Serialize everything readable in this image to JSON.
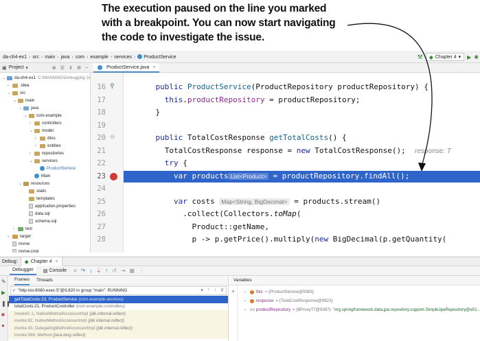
{
  "callout": {
    "text_line1": "The execution paused on the line you marked",
    "text_line2": "with a breakpoint. You can now start navigating",
    "text_line3": "the code to investigate the issue."
  },
  "breadcrumb": [
    "da-ch4-ex1",
    "src",
    "main",
    "java",
    "com",
    "example",
    "services",
    "ProductService"
  ],
  "toolbar": {
    "run_config": "Chapter 4"
  },
  "project_panel": {
    "title": "Project",
    "tree": [
      {
        "label": "da-ch4-ex1",
        "hint": "C:\\MANNING\\Debugging Java Applications\\CODE\\splica3\\code\\da-ch4-ex1",
        "depth": 0,
        "type": "folder-blue",
        "open": true
      },
      {
        "label": ".idea",
        "depth": 1,
        "type": "folder",
        "open": false
      },
      {
        "label": "src",
        "depth": 1,
        "type": "folder",
        "open": true
      },
      {
        "label": "main",
        "depth": 2,
        "type": "folder",
        "open": true
      },
      {
        "label": "java",
        "depth": 3,
        "type": "folder-src",
        "open": true
      },
      {
        "label": "com.example",
        "depth": 4,
        "type": "folder",
        "open": true
      },
      {
        "label": "controllers",
        "depth": 5,
        "type": "folder",
        "open": false
      },
      {
        "label": "model",
        "depth": 5,
        "type": "folder",
        "open": true
      },
      {
        "label": "dtos",
        "depth": 6,
        "type": "folder",
        "open": false
      },
      {
        "label": "entities",
        "depth": 6,
        "type": "folder",
        "open": false
      },
      {
        "label": "repositories",
        "depth": 5,
        "type": "folder",
        "open": false
      },
      {
        "label": "services",
        "depth": 5,
        "type": "folder",
        "open": true
      },
      {
        "label": "ProductService",
        "depth": 6,
        "type": "class",
        "selected": true
      },
      {
        "label": "Main",
        "depth": 5,
        "type": "class"
      },
      {
        "label": "resources",
        "depth": 3,
        "type": "folder-res",
        "open": true
      },
      {
        "label": "static",
        "depth": 4,
        "type": "folder"
      },
      {
        "label": "templates",
        "depth": 4,
        "type": "folder"
      },
      {
        "label": "application.properties",
        "depth": 4,
        "type": "file"
      },
      {
        "label": "data.sql",
        "depth": 4,
        "type": "file"
      },
      {
        "label": "schema.sql",
        "depth": 4,
        "type": "file"
      },
      {
        "label": "test",
        "depth": 2,
        "type": "folder-test",
        "open": false
      },
      {
        "label": "target",
        "depth": 1,
        "type": "folder-orange",
        "open": false
      },
      {
        "label": "mvnw",
        "depth": 1,
        "type": "file"
      },
      {
        "label": "mvnw.cmd",
        "depth": 1,
        "type": "file"
      }
    ]
  },
  "editor": {
    "tab_label": "ProductService.java",
    "lines": [
      {
        "no": "16",
        "parts": [
          {
            "t": "    "
          },
          {
            "t": "public ",
            "c": "kw"
          },
          {
            "t": "ProductService",
            "c": "fn"
          },
          {
            "t": "(ProductRepository productRepository) {"
          }
        ]
      },
      {
        "no": "17",
        "parts": [
          {
            "t": "      "
          },
          {
            "t": "this",
            "c": "kw"
          },
          {
            "t": "."
          },
          {
            "t": "productRepository",
            "c": "fld"
          },
          {
            "t": " = productRepository;"
          }
        ]
      },
      {
        "no": "18",
        "parts": [
          {
            "t": "    }"
          }
        ]
      },
      {
        "no": "19",
        "parts": [
          {
            "t": ""
          }
        ]
      },
      {
        "no": "20",
        "parts": [
          {
            "t": "    "
          },
          {
            "t": "public ",
            "c": "kw"
          },
          {
            "t": "TotalCostResponse "
          },
          {
            "t": "getTotalCosts",
            "c": "fn"
          },
          {
            "t": "() {"
          }
        ]
      },
      {
        "no": "21",
        "parts": [
          {
            "t": "      TotalCostResponse response = "
          },
          {
            "t": "new ",
            "c": "kw"
          },
          {
            "t": "TotalCostResponse();  "
          },
          {
            "t": "response: T",
            "c": "inline"
          }
        ]
      },
      {
        "no": "22",
        "parts": [
          {
            "t": "      "
          },
          {
            "t": "try",
            "c": "kw"
          },
          {
            "t": " {"
          }
        ]
      },
      {
        "no": "23",
        "exec": true,
        "parts": [
          {
            "t": "        "
          },
          {
            "t": "var ",
            "c": "kw"
          },
          {
            "t": "products"
          },
          {
            "t": "List<Product>",
            "c": "hint"
          },
          {
            "t": " = "
          },
          {
            "t": "productRepository",
            "c": "fld"
          },
          {
            "t": ".findAll();"
          }
        ]
      },
      {
        "no": "24",
        "parts": [
          {
            "t": ""
          }
        ]
      },
      {
        "no": "25",
        "parts": [
          {
            "t": "        "
          },
          {
            "t": "var ",
            "c": "kw"
          },
          {
            "t": "costs "
          },
          {
            "t": "Map<String, BigDecimal>",
            "c": "hint"
          },
          {
            "t": " = products.stream()"
          }
        ]
      },
      {
        "no": "26",
        "parts": [
          {
            "t": "          .collect(Collectors."
          },
          {
            "t": "toMap",
            "c": "it"
          },
          {
            "t": "("
          }
        ]
      },
      {
        "no": "27",
        "parts": [
          {
            "t": "            Product::getName,"
          }
        ]
      },
      {
        "no": "28",
        "parts": [
          {
            "t": "            p -> p.getPrice().multiply("
          },
          {
            "t": "new ",
            "c": "kw"
          },
          {
            "t": "BigDecimal(p.getQuantity("
          }
        ]
      }
    ]
  },
  "debug": {
    "label": "Debug:",
    "session_tab": "Chapter 4",
    "tabs": [
      "Debugger",
      "Console"
    ],
    "frames_tabs": [
      "Frames",
      "Threads"
    ],
    "thread": "\"http-nio-8080-exec-5\"@9,820 in group \"main\": RUNNING",
    "frames": [
      {
        "text": "getTotalCosts:23, ProductService",
        "loc": "(com.example.services)",
        "kind": "sel"
      },
      {
        "text": "totalCosts:21, ProductController",
        "loc": "(com.example.controllers)",
        "kind": "normal"
      },
      {
        "text": "invoke0:-1, NativeMethodAccessorImpl",
        "loc": "(jdk.internal.reflect)",
        "kind": "lib"
      },
      {
        "text": "invoke:62, NativeMethodAccessorImpl",
        "loc": "(jdk.internal.reflect)",
        "kind": "lib"
      },
      {
        "text": "invoke:43, DelegatingMethodAccessorImpl",
        "loc": "(jdk.internal.reflect)",
        "kind": "lib"
      },
      {
        "text": "invoke:566, Method",
        "loc": "(java.lang.reflect)",
        "kind": "lib"
      }
    ],
    "variables_title": "Variables",
    "variables": [
      {
        "name": "this",
        "value": "= {ProductService@9385}",
        "color": "#e07a2a"
      },
      {
        "name": "response",
        "value": "= {TotalCostResponse@9823}",
        "color": "#e07a2a"
      },
      {
        "name": "productRepository",
        "value": "= {$Proxy77@9387}",
        "value2": "\"org.springframework.data.jpa.repository.support.SimpleJpaRepository@e51...",
        "color": "#3a8aba",
        "prefix": "oo"
      }
    ]
  },
  "colors": {
    "exec_line": "#2f65ca",
    "breakpoint": "#d33a3a"
  }
}
